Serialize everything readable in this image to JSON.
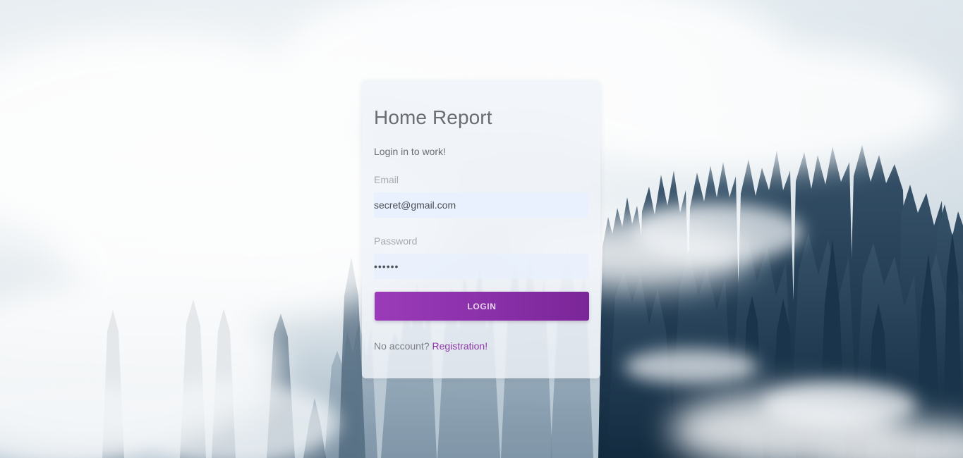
{
  "login_form": {
    "title": "Home Report",
    "subtitle": "Login in to work!",
    "email": {
      "label": "Email",
      "value": "secret@gmail.com"
    },
    "password": {
      "label": "Password",
      "value": "••••••"
    },
    "button_label": "LOGIN",
    "register_prompt": "No account?",
    "register_link": "Registration!"
  },
  "colors": {
    "accent": "#8e38a8",
    "button_start": "#9b3bb9",
    "button_end": "#7a2598",
    "input_background": "#e8f0fe",
    "card_background": "#eff3f7"
  }
}
